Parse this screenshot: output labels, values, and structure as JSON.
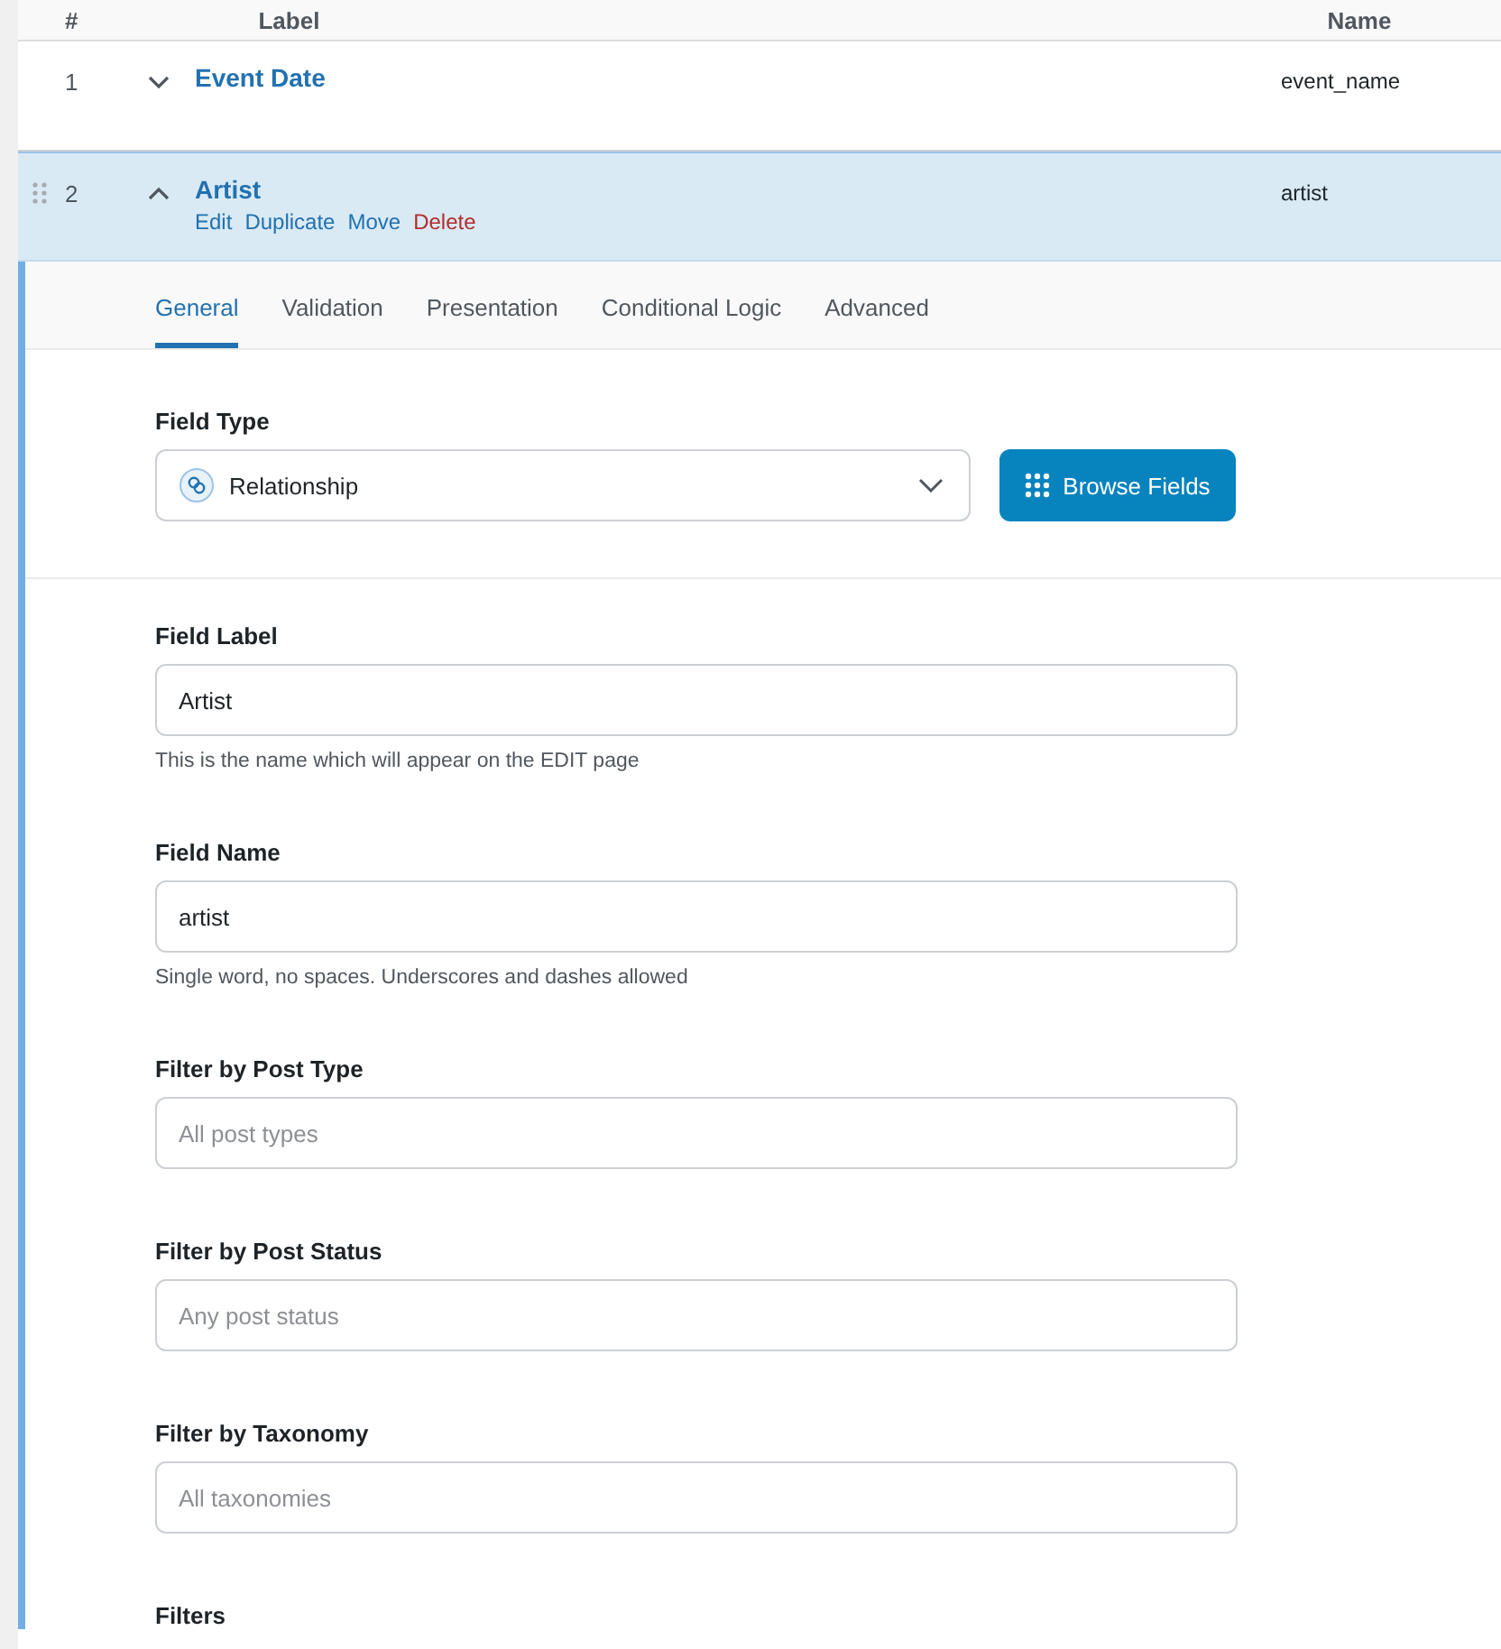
{
  "table": {
    "columns": [
      "#",
      "Label",
      "Name"
    ],
    "rows": [
      {
        "order": "1",
        "label": "Event Date",
        "name": "event_name",
        "expanded": false,
        "actions": []
      },
      {
        "order": "2",
        "label": "Artist",
        "name": "artist",
        "expanded": true,
        "actions": [
          {
            "label": "Edit",
            "kind": "normal"
          },
          {
            "label": "Duplicate",
            "kind": "normal"
          },
          {
            "label": "Move",
            "kind": "normal"
          },
          {
            "label": "Delete",
            "kind": "danger"
          }
        ]
      }
    ]
  },
  "settings": {
    "tabs": [
      {
        "label": "General",
        "selected": true
      },
      {
        "label": "Validation",
        "selected": false
      },
      {
        "label": "Presentation",
        "selected": false
      },
      {
        "label": "Conditional Logic",
        "selected": false
      },
      {
        "label": "Advanced",
        "selected": false
      }
    ],
    "field_type": {
      "label": "Field Type",
      "value": "Relationship",
      "button": "Browse Fields"
    },
    "fields": [
      {
        "label": "Field Label",
        "value": "Artist",
        "hint": "This is the name which will appear on the EDIT page"
      },
      {
        "label": "Field Name",
        "value": "artist",
        "hint": "Single word, no spaces. Underscores and dashes allowed"
      },
      {
        "label": "Filter by Post Type",
        "placeholder": "All post types"
      },
      {
        "label": "Filter by Post Status",
        "placeholder": "Any post status"
      },
      {
        "label": "Filter by Taxonomy",
        "placeholder": "All taxonomies"
      }
    ],
    "filters": {
      "label": "Filters"
    }
  }
}
